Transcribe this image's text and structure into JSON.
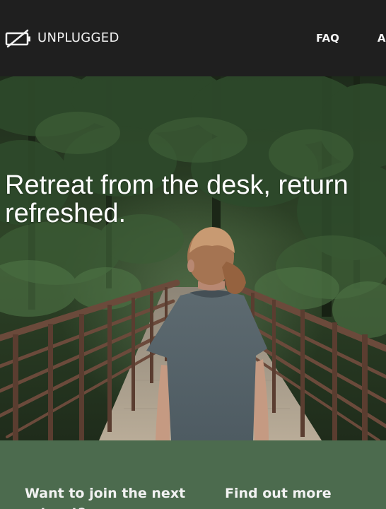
{
  "brand": {
    "name": "UNPLUGGED",
    "icon": "unplugged-battery-icon"
  },
  "nav": {
    "items": [
      "FAQ",
      "A"
    ]
  },
  "hero": {
    "title": "Retreat from the desk, return\nrefreshed.",
    "image": "woman-walking-on-wooden-bridge-in-forest"
  },
  "cta": {
    "join_heading": "Want to join the next retreat?",
    "more_heading": "Find out more"
  },
  "colors": {
    "header_bg": "#1f1f1f",
    "cta_band_bg": "#4c6b4e",
    "text": "#f2f2f2"
  }
}
